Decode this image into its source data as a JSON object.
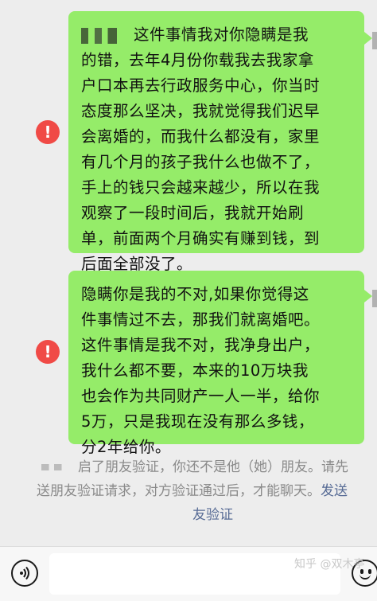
{
  "messages": [
    {
      "sender_hidden": true,
      "status": "failed",
      "lines": [
        "这件事情我对你隐瞒是我",
        "的错，去年4月份你载我去我家拿",
        "户口本再去行政服务中心，你当时",
        "态度那么坚决，我就觉得我们迟早",
        "会离婚的，而我什么都没有，家里",
        "有几个月的孩子我什么也做不了，",
        "手上的钱只会越来越少，所以在我",
        "观察了一段时间后，我就开始刷",
        "单，前面两个月确实有赚到钱，到",
        "后面全部没了。"
      ]
    },
    {
      "status": "failed",
      "lines": [
        "隐瞒你是我的不对,如果你觉得这",
        "件事情过不去，那我们就离婚吧。",
        "这件事情是我不对，我净身出户，",
        "我什么都不要，本来的10万块我",
        "也会作为共同财产一人一半，给你",
        "5万，只是我现在没有那么多钱，",
        "分2年给你。"
      ]
    }
  ],
  "system_notice": {
    "line1": "启了朋友验证，你还不是他（她）朋友。请先",
    "line2_prefix": "送朋友验证请求，对方验证通过后，才能聊天。",
    "line2_link": "发送",
    "line3_link": "友验证"
  },
  "error_icon_glyph": "!",
  "watermark": "知乎 @双木亭",
  "colors": {
    "bubble": "#95ec69",
    "error": "#f04a46",
    "link": "#576b95",
    "chat_bg": "#ededed"
  },
  "icons": {
    "voice": "voice-icon",
    "emoji": "emoji-icon",
    "error": "error-icon"
  }
}
